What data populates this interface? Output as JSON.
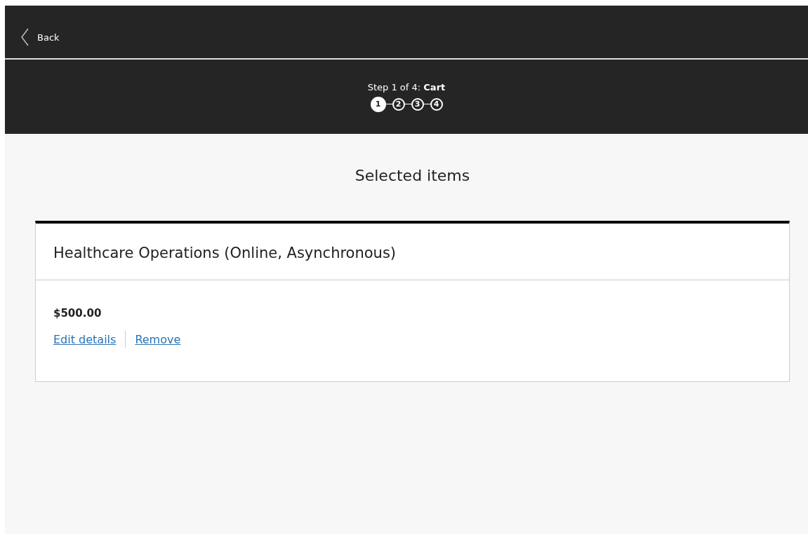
{
  "header": {
    "back": "Back",
    "step_title": "Step 1 of 4: **Cart**",
    "steps": [
      {
        "label": "1",
        "selected": true
      },
      {
        "label": "2",
        "selected": false
      },
      {
        "label": "3",
        "selected": false
      },
      {
        "label": "4",
        "selected": false
      }
    ]
  },
  "heading": "Selected items",
  "items": [
    {
      "title": "Healthcare Operations (Online, Asynchronous)",
      "price": "$500.00",
      "links": [
        "Edit details",
        "Remove"
      ]
    }
  ]
}
